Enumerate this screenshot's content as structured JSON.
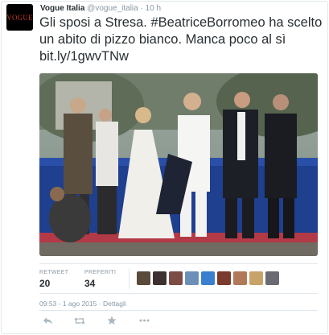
{
  "user": {
    "display_name": "Vogue Italia",
    "handle": "@vogue_italia",
    "separator": "·",
    "time": "10 h",
    "avatar_text": "VOGUE"
  },
  "tweet": {
    "text": "Gli sposi a Stresa. #BeatriceBorromeo ha scelto un abito di pizzo bianco. Manca poco al sì bit.ly/1gwvTNw"
  },
  "stats": {
    "retweet_label": "RETWEET",
    "retweet_count": "20",
    "favorite_label": "PREFERITI",
    "favorite_count": "34"
  },
  "favoriters": [
    {
      "name": "avatar-1",
      "color": "#5a4a3a"
    },
    {
      "name": "avatar-2",
      "color": "#3d3030"
    },
    {
      "name": "avatar-3",
      "color": "#7b4b44"
    },
    {
      "name": "avatar-4",
      "color": "#6c8fb8"
    },
    {
      "name": "avatar-5",
      "color": "#3b7fd0"
    },
    {
      "name": "avatar-6",
      "color": "#7a3a2e"
    },
    {
      "name": "avatar-7",
      "color": "#b07a5a"
    },
    {
      "name": "avatar-8",
      "color": "#c7a36a"
    },
    {
      "name": "avatar-9",
      "color": "#6a6a72"
    }
  ],
  "meta": {
    "datetime": "09:53 - 1 ago 2015",
    "separator": "·",
    "details": "Dettagli"
  },
  "icons": {
    "reply": "reply-icon",
    "retweet": "retweet-icon",
    "favorite": "star-icon",
    "more": "more-icon"
  }
}
